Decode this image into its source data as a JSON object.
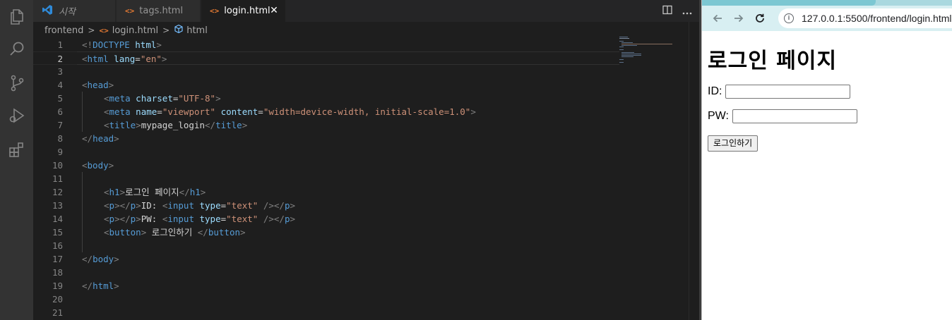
{
  "editor": {
    "tabs": [
      {
        "label": "시작",
        "icon": "vscode-logo-icon",
        "active": false
      },
      {
        "label": "tags.html",
        "icon": "html-file-icon",
        "active": false
      },
      {
        "label": "login.html",
        "icon": "html-file-icon",
        "active": true
      }
    ],
    "tab_icon_glyph": "<>",
    "close_glyph": "✕",
    "breadcrumb": [
      "frontend",
      "login.html",
      "html"
    ],
    "breadcrumb_sep": ">",
    "current_line": 2,
    "line_numbers": [
      "1",
      "2",
      "3",
      "4",
      "5",
      "6",
      "7",
      "8",
      "9",
      "10",
      "11",
      "12",
      "13",
      "14",
      "15",
      "16",
      "17",
      "18",
      "19",
      "20",
      "21"
    ],
    "code": {
      "l1": {
        "p1": "<!",
        "t1": "DOCTYPE",
        "a1": " html",
        "p2": ">"
      },
      "l2": {
        "p1": "<",
        "t1": "html",
        "a1": " lang",
        "x1": "=",
        "s1": "\"en\"",
        "p2": ">"
      },
      "l4": {
        "p1": "<",
        "t1": "head",
        "p2": ">"
      },
      "l5": {
        "p1": "<",
        "t1": "meta",
        "a1": " charset",
        "x1": "=",
        "s1": "\"UTF-8\"",
        "p2": ">"
      },
      "l6": {
        "p1": "<",
        "t1": "meta",
        "a1": " name",
        "x1": "=",
        "s1": "\"viewport\"",
        "a2": " content",
        "x2": "=",
        "s2": "\"width=device-width, initial-scale=1.0\"",
        "p2": ">"
      },
      "l7": {
        "p1": "<",
        "t1": "title",
        "p2": ">",
        "txt": "mypage_login",
        "p3": "</",
        "t2": "title",
        "p4": ">"
      },
      "l8": {
        "p1": "</",
        "t1": "head",
        "p2": ">"
      },
      "l10": {
        "p1": "<",
        "t1": "body",
        "p2": ">"
      },
      "l12": {
        "p1": "<",
        "t1": "h1",
        "p2": ">",
        "txt": "로그인 페이지",
        "p3": "</",
        "t2": "h1",
        "p4": ">"
      },
      "l13": {
        "p1": "<",
        "t1": "p",
        "p2": "></",
        "t2": "p",
        "p3": ">",
        "txt": "ID: ",
        "p4": "<",
        "t3": "input",
        "a1": " type",
        "x1": "=",
        "s1": "\"text\"",
        "p5": " /></",
        "t4": "p",
        "p6": ">"
      },
      "l14": {
        "p1": "<",
        "t1": "p",
        "p2": "></",
        "t2": "p",
        "p3": ">",
        "txt": "PW: ",
        "p4": "<",
        "t3": "input",
        "a1": " type",
        "x1": "=",
        "s1": "\"text\"",
        "p5": " /></",
        "t4": "p",
        "p6": ">"
      },
      "l15": {
        "p1": "<",
        "t1": "button",
        "p2": ">",
        "txt": " 로그인하기 ",
        "p3": "</",
        "t2": "button",
        "p4": ">"
      },
      "l17": {
        "p1": "</",
        "t1": "body",
        "p2": ">"
      },
      "l19": {
        "p1": "</",
        "t1": "html",
        "p2": ">"
      }
    }
  },
  "browser": {
    "url": "127.0.0.1:5500/frontend/login.html",
    "page": {
      "heading": "로그인 페이지",
      "id_label": "ID:",
      "pw_label": "PW:",
      "button_label": "로그인하기"
    }
  },
  "colors": {
    "tag": "#569cd6",
    "attr": "#9cdcfe",
    "string": "#ce9178",
    "punct": "#808080",
    "html_icon": "#e37933"
  }
}
